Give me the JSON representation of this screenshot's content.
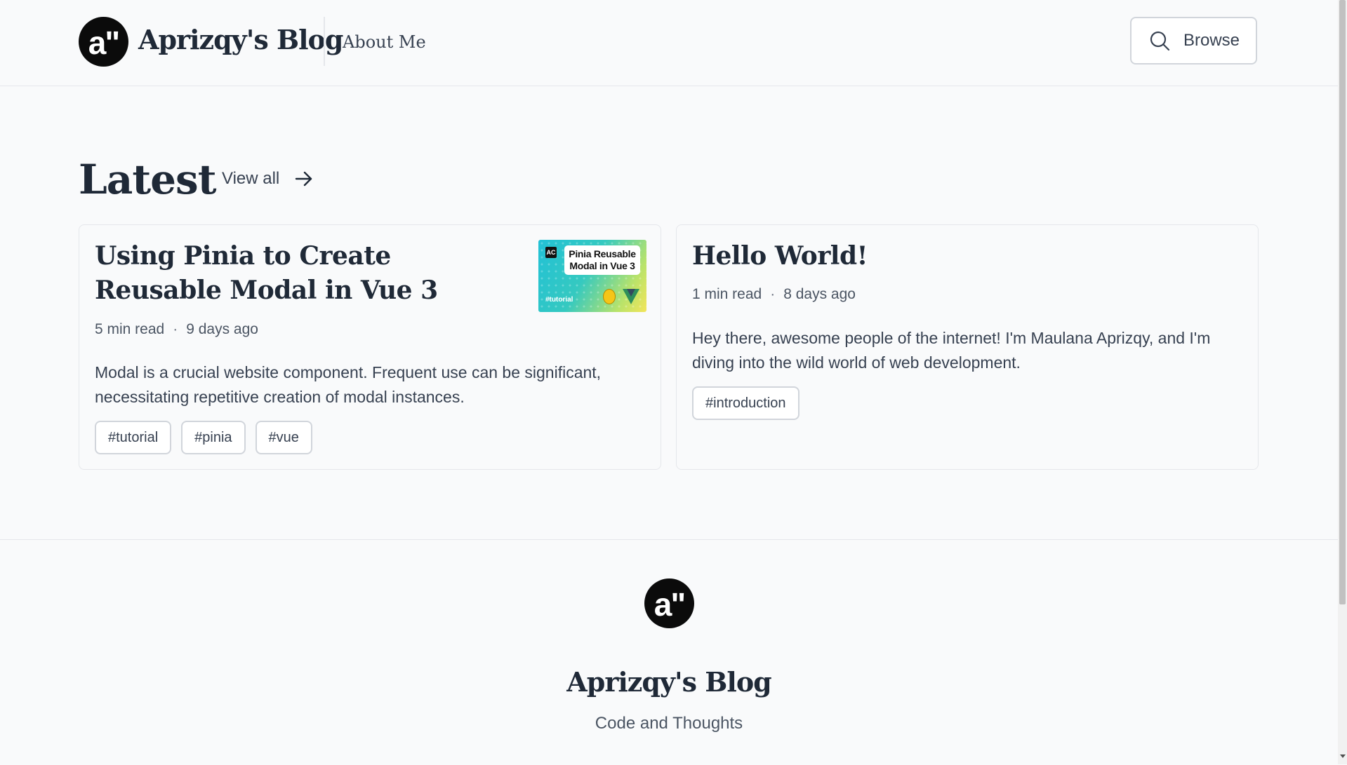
{
  "header": {
    "logo_mark": "a\"",
    "site_title": "Aprizqy's Blog",
    "nav": {
      "about": "About Me"
    },
    "browse_label": "Browse"
  },
  "latest": {
    "heading": "Latest",
    "view_all": "View all",
    "posts": [
      {
        "title": "Using Pinia to Create Reusable Modal in Vue 3",
        "read_time": "5 min read",
        "date": "9 days ago",
        "excerpt": "Modal is a crucial website component. Frequent use can be significant, necessitating repetitive creation of modal instances.",
        "tags": [
          "#tutorial",
          "#pinia",
          "#vue"
        ],
        "thumbnail": {
          "badge": "AC",
          "caption": "Pinia Reusable Modal in Vue 3",
          "tag": "#tutorial"
        }
      },
      {
        "title": "Hello World!",
        "read_time": "1 min read",
        "date": "8 days ago",
        "excerpt": "Hey there, awesome people of the internet! I'm Maulana Aprizqy, and I'm diving into the wild world of web development.",
        "tags": [
          "#introduction"
        ]
      }
    ]
  },
  "footer": {
    "logo_mark": "a\"",
    "title": "Aprizqy's Blog",
    "tagline": "Code and Thoughts"
  },
  "colors": {
    "background": "#f9fafb",
    "text": "#1f2937",
    "border": "#e5e7eb",
    "logo": "#0b0b0b"
  }
}
